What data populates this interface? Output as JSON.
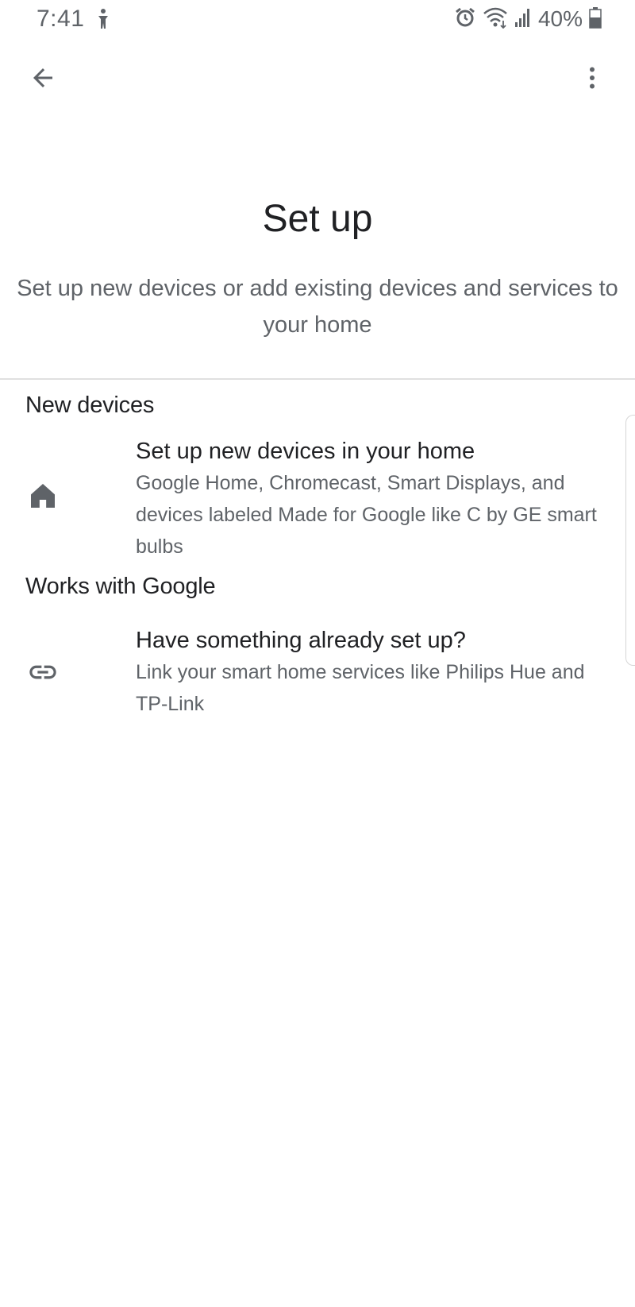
{
  "status_bar": {
    "time": "7:41",
    "battery": "40%"
  },
  "app_bar": {
    "back_icon": "arrow-left-icon",
    "more_icon": "more-vert-icon"
  },
  "page": {
    "title": "Set up",
    "subtitle": "Set up new devices or add existing devices and services to your home"
  },
  "sections": {
    "new_devices": {
      "header": "New devices",
      "item": {
        "icon": "home-icon",
        "title": "Set up new devices in your home",
        "description": "Google Home, Chromecast, Smart Displays, and devices labeled Made for Google like C by GE smart bulbs"
      }
    },
    "works_with_google": {
      "header": "Works with Google",
      "item": {
        "icon": "link-icon",
        "title": "Have something already set up?",
        "description": "Link your smart home services like Philips Hue and TP-Link"
      }
    }
  },
  "colors": {
    "primary_text": "#202124",
    "secondary_text": "#5f6368",
    "icon": "#5f6368",
    "divider": "#e0e0e0",
    "background": "#ffffff"
  }
}
